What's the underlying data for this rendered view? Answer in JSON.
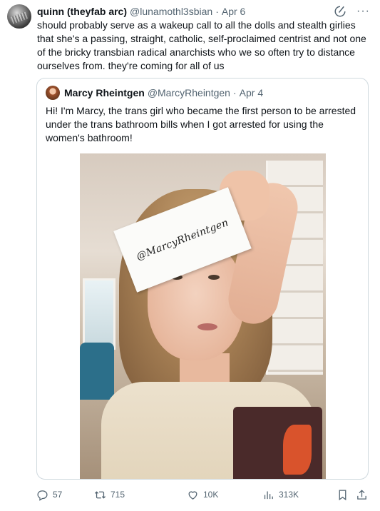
{
  "tweet": {
    "author_name": "quinn (theyfab arc)",
    "author_handle": "@lunamothl3sbian",
    "separator": "·",
    "date": "Apr 6",
    "more": "···",
    "text": "should probably serve as a wakeup call to all the dolls and stealth girlies that she's a passing, straight, catholic, self-proclaimed centrist and not one of the bricky transbian radical anarchists who we so often try to distance ourselves from. they're coming for all of us"
  },
  "quote": {
    "author_name": "Marcy Rheintgen",
    "author_handle": "@MarcyRheintgen",
    "separator": "·",
    "date": "Apr 4",
    "text": "Hi! I'm Marcy, the trans girl who became the first person to be arrested under the trans bathroom bills when I got arrested for using the women's bathroom!",
    "photo_sign_text": "@MarcyRheintgen"
  },
  "actions": {
    "replies": "57",
    "retweets": "715",
    "likes": "10K",
    "views": "313K"
  },
  "icons": {
    "grok": "grok-icon",
    "more": "more-icon",
    "reply": "reply-icon",
    "retweet": "retweet-icon",
    "like": "heart-icon",
    "views": "views-icon",
    "bookmark": "bookmark-icon",
    "share": "share-icon"
  },
  "colors": {
    "text": "#0f1419",
    "secondary": "#536471",
    "border": "#cfd9de"
  }
}
